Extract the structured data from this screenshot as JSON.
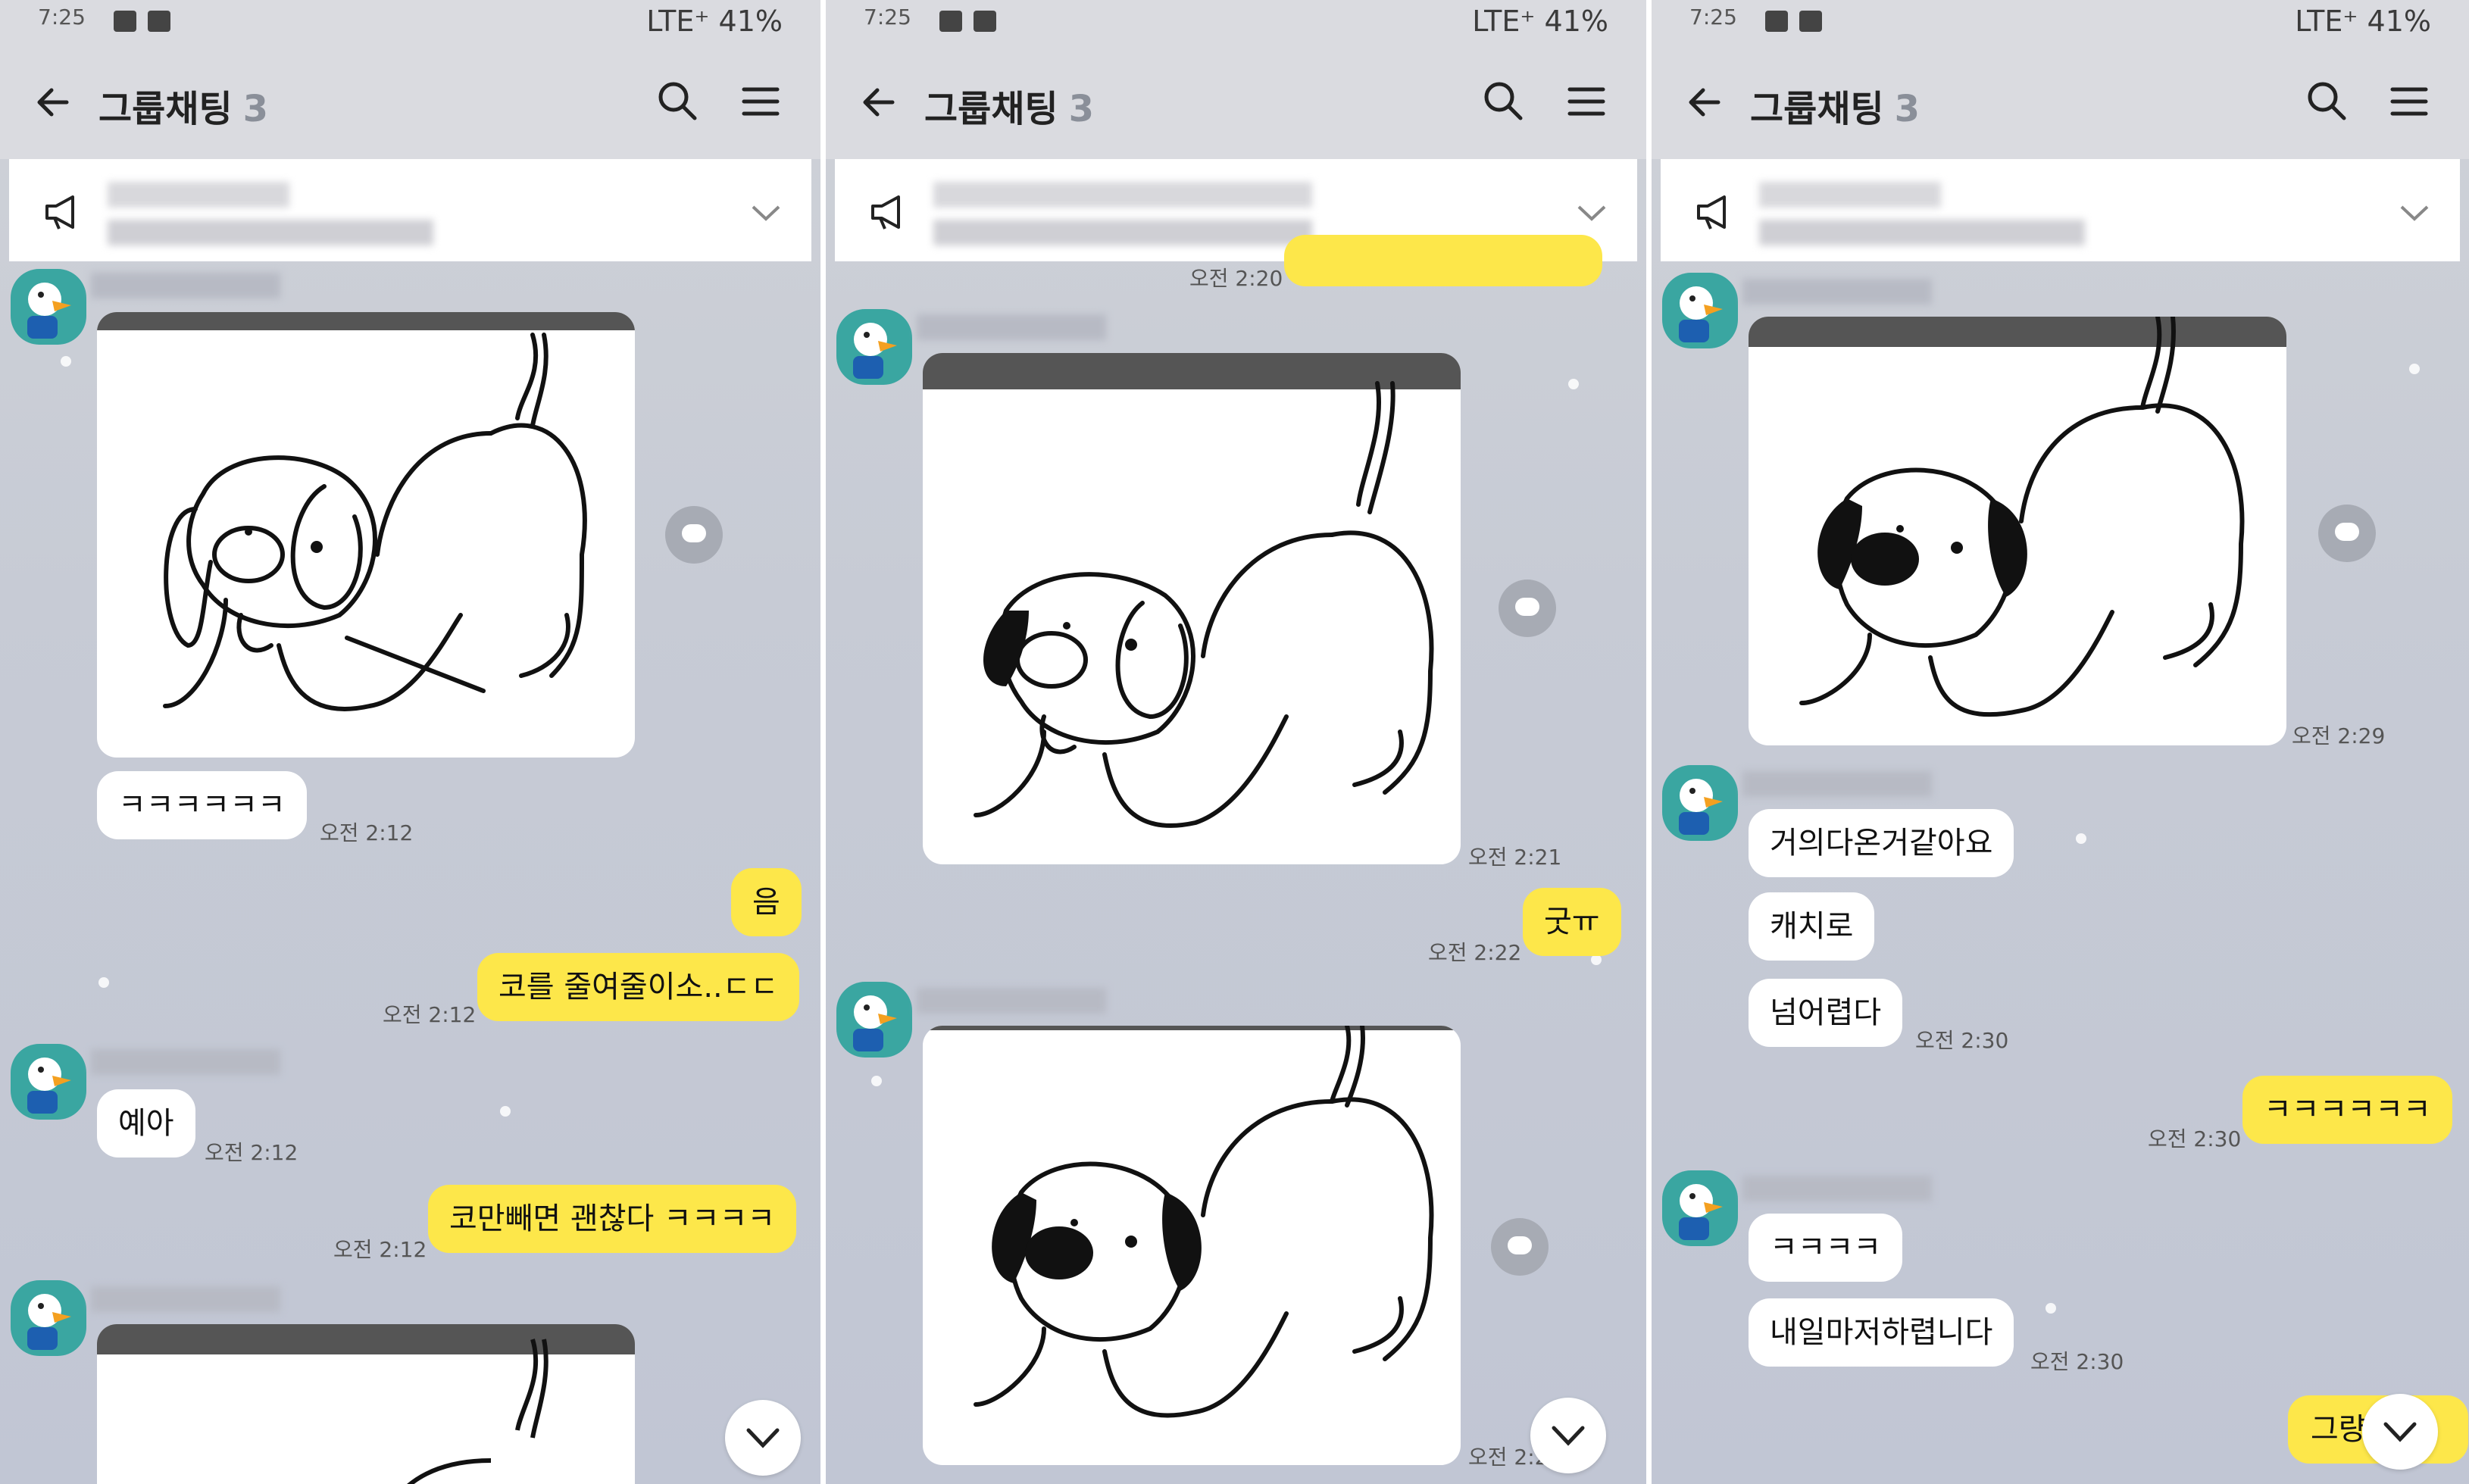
{
  "status": {
    "time": "7:25",
    "network": "LTE⁺",
    "battery": "41%"
  },
  "header": {
    "title": "그룹채팅",
    "member_count": "3"
  },
  "panels": [
    {
      "messages": {
        "m1_text": "ㅋㅋㅋㅋㅋㅋ",
        "m1_time": "오전 2:12",
        "m2_text": "음",
        "m3_text": "코를 줄여줄이소..ㄷㄷ",
        "m3_time": "오전 2:12",
        "m4_text": "예아",
        "m4_time": "오전 2:12",
        "m5_text": "코만빼면 괜찮다 ㅋㅋㅋㅋ",
        "m5_time": "오전 2:12"
      }
    },
    {
      "messages": {
        "t0": "오전 2:20",
        "photo1_time": "오전 2:21",
        "m1_text": "굿ㅠ",
        "m1_time": "오전 2:22",
        "photo2_time": "오전 2:27"
      }
    },
    {
      "messages": {
        "photo1_time": "오전 2:29",
        "m1_text": "거의다온거같아요",
        "m2_text": "캐치로",
        "m3_text": "넘어렵다",
        "m3_time": "오전 2:30",
        "m4_text": "ㅋㅋㅋㅋㅋㅋ",
        "m4_time": "오전 2:30",
        "m5_text": "ㅋㅋㅋㅋ",
        "m6_text": "내일마저하렵니다",
        "m6_time": "오전 2:30",
        "m7_text": "그량"
      }
    }
  ],
  "icons": {
    "back": "arrow-left-icon",
    "search": "search-icon",
    "menu": "hamburger-menu-icon",
    "notice": "megaphone-icon",
    "expand": "chevron-down-icon",
    "share": "share-bubble-icon",
    "scroll_down": "chevron-down-icon"
  },
  "colors": {
    "outgoing_bubble": "#fde74a",
    "incoming_bubble": "#ffffff",
    "chat_bg": "#c7cbd5"
  }
}
